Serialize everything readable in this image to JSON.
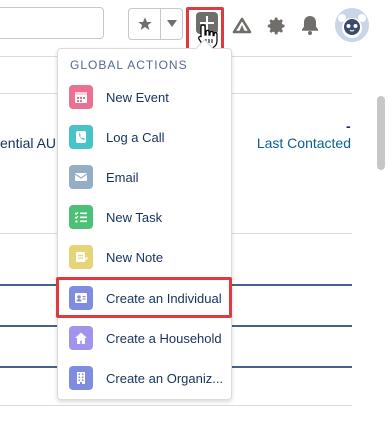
{
  "header": {
    "search_placeholder": "",
    "favorites_icon": "star-icon",
    "favorites_menu_icon": "chevron-down-icon",
    "global_actions_icon": "plus-icon",
    "help_icon": "trailhead-icon",
    "setup_icon": "gear-icon",
    "notifications_icon": "bell-icon",
    "avatar_icon": "astro-avatar-icon"
  },
  "background": {
    "left_column_fragment": "ential AU",
    "right_column_header": "Last Contacted",
    "dash": "-"
  },
  "menu": {
    "header": "GLOBAL ACTIONS",
    "items": [
      {
        "label": "New Event",
        "icon": "calendar-icon",
        "color": "#eb7092"
      },
      {
        "label": "Log a Call",
        "icon": "phone-icon",
        "color": "#48c3cc"
      },
      {
        "label": "Email",
        "icon": "email-icon",
        "color": "#95aec5"
      },
      {
        "label": "New Task",
        "icon": "task-icon",
        "color": "#4bc076"
      },
      {
        "label": "New Note",
        "icon": "note-icon",
        "color": "#e6d478"
      },
      {
        "label": "Create an Individual",
        "icon": "individual-icon",
        "color": "#7f8de1"
      },
      {
        "label": "Create a Household",
        "icon": "household-icon",
        "color": "#a094ed"
      },
      {
        "label": "Create an Organiz...",
        "icon": "organization-icon",
        "color": "#7f8de1"
      }
    ]
  },
  "colors": {
    "highlight": "#e0393e",
    "text": "#16325c",
    "link": "#0b6098"
  }
}
